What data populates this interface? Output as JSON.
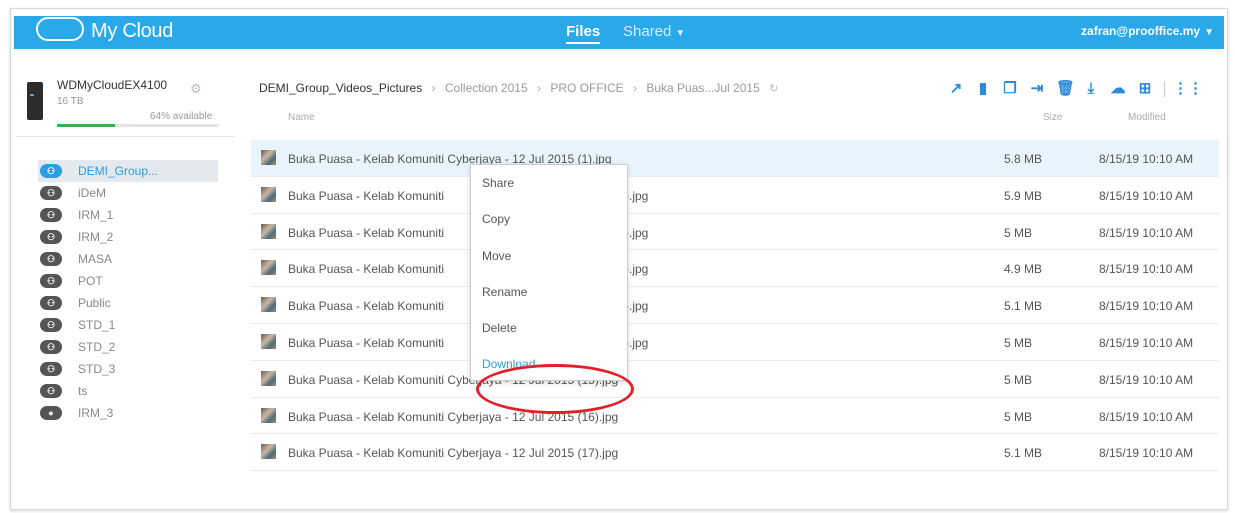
{
  "header": {
    "app_title": "My Cloud",
    "nav_files": "Files",
    "nav_shared": "Shared",
    "user": "zafran@prooffice.my"
  },
  "device": {
    "name": "WDMyCloudEX4100",
    "capacity": "16 TB",
    "available": "64% available",
    "used_fraction": 0.36
  },
  "shares": [
    {
      "label": "DEMI_Group...",
      "icon": "cloud-share-icon",
      "active": true
    },
    {
      "label": "iDeM",
      "icon": "cloud-share-icon"
    },
    {
      "label": "IRM_1",
      "icon": "cloud-share-icon"
    },
    {
      "label": "IRM_2",
      "icon": "cloud-share-icon"
    },
    {
      "label": "MASA",
      "icon": "cloud-share-icon"
    },
    {
      "label": "POT",
      "icon": "cloud-share-icon"
    },
    {
      "label": "Public",
      "icon": "cloud-share-icon"
    },
    {
      "label": "STD_1",
      "icon": "cloud-share-icon"
    },
    {
      "label": "STD_2",
      "icon": "cloud-share-icon"
    },
    {
      "label": "STD_3",
      "icon": "cloud-share-icon"
    },
    {
      "label": "ts",
      "icon": "cloud-share-icon"
    },
    {
      "label": "IRM_3",
      "icon": "eye-share-icon"
    }
  ],
  "breadcrumb": {
    "root": "DEMI_Group_Videos_Pictures",
    "c1": "Collection 2015",
    "c2": "PRO OFFICE",
    "c3": "Buka Puas...Jul 2015"
  },
  "columns": {
    "name": "Name",
    "size": "Size",
    "modified": "Modified"
  },
  "files": [
    {
      "name": "Buka Puasa - Kelab Komuniti Cyberjaya - 12 Jul 2015 (1).jpg",
      "size": "5.8 MB",
      "modified": "8/15/19 10:10 AM"
    },
    {
      "name": "Buka Puasa - Kelab Komuniti",
      "tail": ").jpg",
      "size": "5.9 MB",
      "modified": "8/15/19 10:10 AM"
    },
    {
      "name": "Buka Puasa - Kelab Komuniti",
      "tail": ").jpg",
      "size": "5 MB",
      "modified": "8/15/19 10:10 AM"
    },
    {
      "name": "Buka Puasa - Kelab Komuniti",
      "tail": ").jpg",
      "size": "4.9 MB",
      "modified": "8/15/19 10:10 AM"
    },
    {
      "name": "Buka Puasa - Kelab Komuniti",
      "tail": ").jpg",
      "size": "5.1 MB",
      "modified": "8/15/19 10:10 AM"
    },
    {
      "name": "Buka Puasa - Kelab Komuniti",
      "tail": ").jpg",
      "size": "5 MB",
      "modified": "8/15/19 10:10 AM"
    },
    {
      "name": "Buka Puasa - Kelab Komuniti Cyberjaya - 12 Jul 2015 (15).jpg",
      "size": "5 MB",
      "modified": "8/15/19 10:10 AM"
    },
    {
      "name": "Buka Puasa - Kelab Komuniti Cyberjaya - 12 Jul 2015 (16).jpg",
      "size": "5 MB",
      "modified": "8/15/19 10:10 AM"
    },
    {
      "name": "Buka Puasa - Kelab Komuniti Cyberjaya - 12 Jul 2015 (17).jpg",
      "size": "5.1 MB",
      "modified": "8/15/19 10:10 AM"
    }
  ],
  "context_menu": {
    "share": "Share",
    "copy": "Copy",
    "move": "Move",
    "rename": "Rename",
    "delete": "Delete",
    "download": "Download"
  },
  "colors": {
    "accent": "#29a9ea",
    "highlight": "#e2202a",
    "storage": "#2fb64a"
  }
}
